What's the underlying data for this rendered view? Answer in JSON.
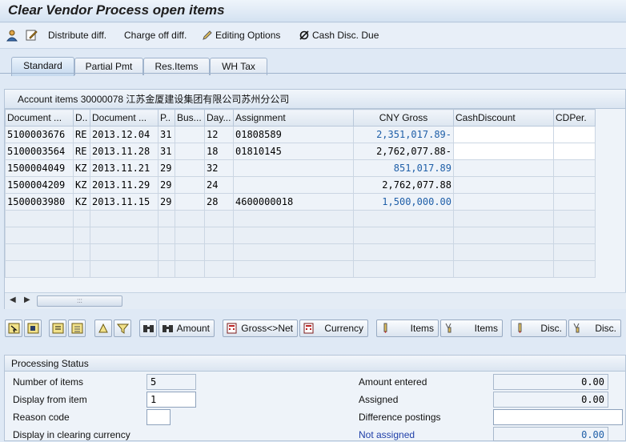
{
  "window": {
    "title": "Clear Vendor Process open items"
  },
  "toolbar": {
    "distribute": "Distribute diff.",
    "charge_off": "Charge off diff.",
    "editing_options": "Editing Options",
    "cash_disc_due": "Cash Disc. Due"
  },
  "tabs": [
    "Standard",
    "Partial Pmt",
    "Res.Items",
    "WH Tax"
  ],
  "grid": {
    "title": "Account items 30000078 江苏金厦建设集团有限公司苏州分公司",
    "columns": [
      "Document ...",
      "D..",
      "Document ...",
      "P..",
      "Bus...",
      "Day...",
      "Assignment",
      "CNY Gross",
      "CashDiscount",
      "CDPer."
    ],
    "rows": [
      [
        "5100003676",
        "RE",
        "2013.12.04",
        "31",
        "",
        "12",
        "01808589",
        "2,351,017.89-",
        "",
        ""
      ],
      [
        "5100003564",
        "RE",
        "2013.11.28",
        "31",
        "",
        "18",
        "01810145",
        "2,762,077.88-",
        "",
        ""
      ],
      [
        "1500004049",
        "KZ",
        "2013.11.21",
        "29",
        "",
        "32",
        "",
        "851,017.89",
        "",
        ""
      ],
      [
        "1500004209",
        "KZ",
        "2013.11.29",
        "29",
        "",
        "24",
        "",
        "2,762,077.88",
        "",
        ""
      ],
      [
        "1500003980",
        "KZ",
        "2013.11.15",
        "29",
        "",
        "28",
        "4600000018",
        "1,500,000.00",
        "",
        ""
      ]
    ],
    "scroll_thumb": ":::"
  },
  "buttons": {
    "amount": "Amount",
    "gross_net": "Gross<>Net",
    "currency": "Currency",
    "items_1": "Items",
    "items_2": "Items",
    "disc_1": "Disc.",
    "disc_2": "Disc."
  },
  "status": {
    "header": "Processing Status",
    "number_of_items_label": "Number of items",
    "number_of_items": "5",
    "display_from_label": "Display from item",
    "display_from": "1",
    "reason_code_label": "Reason code",
    "reason_code": "",
    "clearing_currency_label": "Display in clearing currency",
    "amount_entered_label": "Amount entered",
    "amount_entered": "0.00",
    "assigned_label": "Assigned",
    "assigned": "0.00",
    "difference_label": "Difference postings",
    "difference": "",
    "not_assigned_label": "Not assigned",
    "not_assigned": "0.00"
  },
  "colors": {
    "accent_blue": "#1f5fa8",
    "background": "#dfe9f5"
  }
}
